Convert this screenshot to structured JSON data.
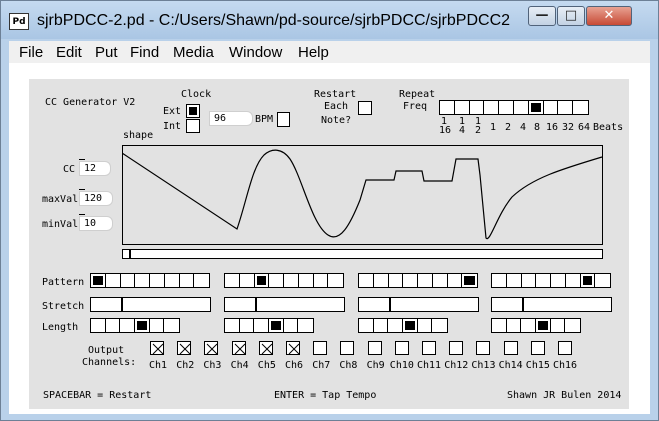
{
  "window": {
    "title": "sjrbPDCC-2.pd  - C:/Users/Shawn/pd-source/sjrbPDCC/sjrbPDCC2",
    "icon_label": "Pd",
    "minimize": "—",
    "maximize": "□",
    "close": "✕"
  },
  "menu": [
    "File",
    "Edit",
    "Put",
    "Find",
    "Media",
    "Window",
    "Help"
  ],
  "patch": {
    "title": "CC Generator V2",
    "clock_label": "Clock",
    "ext_label": "Ext",
    "int_label": "Int",
    "bpm_value": "96",
    "bpm_label": "BPM",
    "restart_line1": "Restart",
    "restart_line2": "Each",
    "restart_line3": "Note?",
    "repeat_line1": "Repeat",
    "repeat_line2": "Freq",
    "repeat_selected_index": 6,
    "repeat_cells": 10,
    "freq_labels": [
      "1",
      "1",
      "1",
      "1",
      "2",
      "4",
      "8",
      "16",
      "32",
      "64",
      "Beats"
    ],
    "freq_denoms": [
      "16",
      "4",
      "2"
    ],
    "shape_label": "shape",
    "cc_label": "CC",
    "cc_value": "12",
    "maxval_label": "maxVal",
    "maxval_value": "120",
    "minval_label": "minVal",
    "minval_value": "10",
    "progress_fraction": 0.01,
    "pattern_label": "Pattern",
    "stretch_label": "Stretch",
    "length_label": "Length",
    "patterns": [
      {
        "cells": 8,
        "on": 0
      },
      {
        "cells": 8,
        "on": 2
      },
      {
        "cells": 8,
        "on": 7
      },
      {
        "cells": 8,
        "on": 6
      }
    ],
    "stretch_fractions": [
      0.26,
      0.26,
      0.26,
      0.26
    ],
    "lengths": [
      {
        "cells": 6,
        "on": 3
      },
      {
        "cells": 6,
        "on": 3
      },
      {
        "cells": 6,
        "on": 3
      },
      {
        "cells": 6,
        "on": 3
      }
    ],
    "output_line1": "Output",
    "output_line2": "Channels:",
    "channels": [
      {
        "label": "Ch1",
        "on": true
      },
      {
        "label": "Ch2",
        "on": true
      },
      {
        "label": "Ch3",
        "on": true
      },
      {
        "label": "Ch4",
        "on": true
      },
      {
        "label": "Ch5",
        "on": true
      },
      {
        "label": "Ch6",
        "on": true
      },
      {
        "label": "Ch7",
        "on": false
      },
      {
        "label": "Ch8",
        "on": false
      },
      {
        "label": "Ch9",
        "on": false
      },
      {
        "label": "Ch10",
        "on": false
      },
      {
        "label": "Ch11",
        "on": false
      },
      {
        "label": "Ch12",
        "on": false
      },
      {
        "label": "Ch13",
        "on": false
      },
      {
        "label": "Ch14",
        "on": false
      },
      {
        "label": "Ch15",
        "on": false
      },
      {
        "label": "Ch16",
        "on": false
      }
    ],
    "footer_left": "SPACEBAR = Restart",
    "footer_center": "ENTER = Tap Tempo",
    "footer_right": "Shawn JR Bulen 2014"
  }
}
